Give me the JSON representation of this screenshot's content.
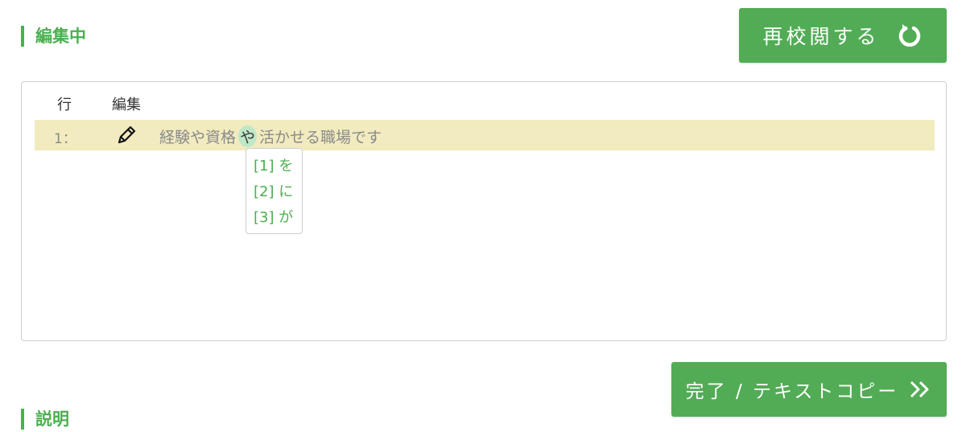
{
  "sections": {
    "editing_title": "編集中",
    "description_title": "説明"
  },
  "buttons": {
    "recheck_label": "再校閲する",
    "done_label": "完了 / テキストコピー"
  },
  "table": {
    "headers": {
      "line": "行",
      "edit": "編集"
    },
    "rows": [
      {
        "line": "1：",
        "text_before": "経験や資格",
        "highlight": "や",
        "text_after": "活かせる職場です"
      }
    ]
  },
  "suggestions": [
    {
      "label": "[1] を"
    },
    {
      "label": "[2] に"
    },
    {
      "label": "[3] が"
    }
  ],
  "icons": {
    "recheck": "refresh-icon",
    "done": "double-chevron-right-icon",
    "edit": "pencil-icon"
  },
  "colors": {
    "accent": "#52ac56",
    "row_highlight": "#f1ebbf",
    "token_highlight": "#bfe8c7"
  }
}
